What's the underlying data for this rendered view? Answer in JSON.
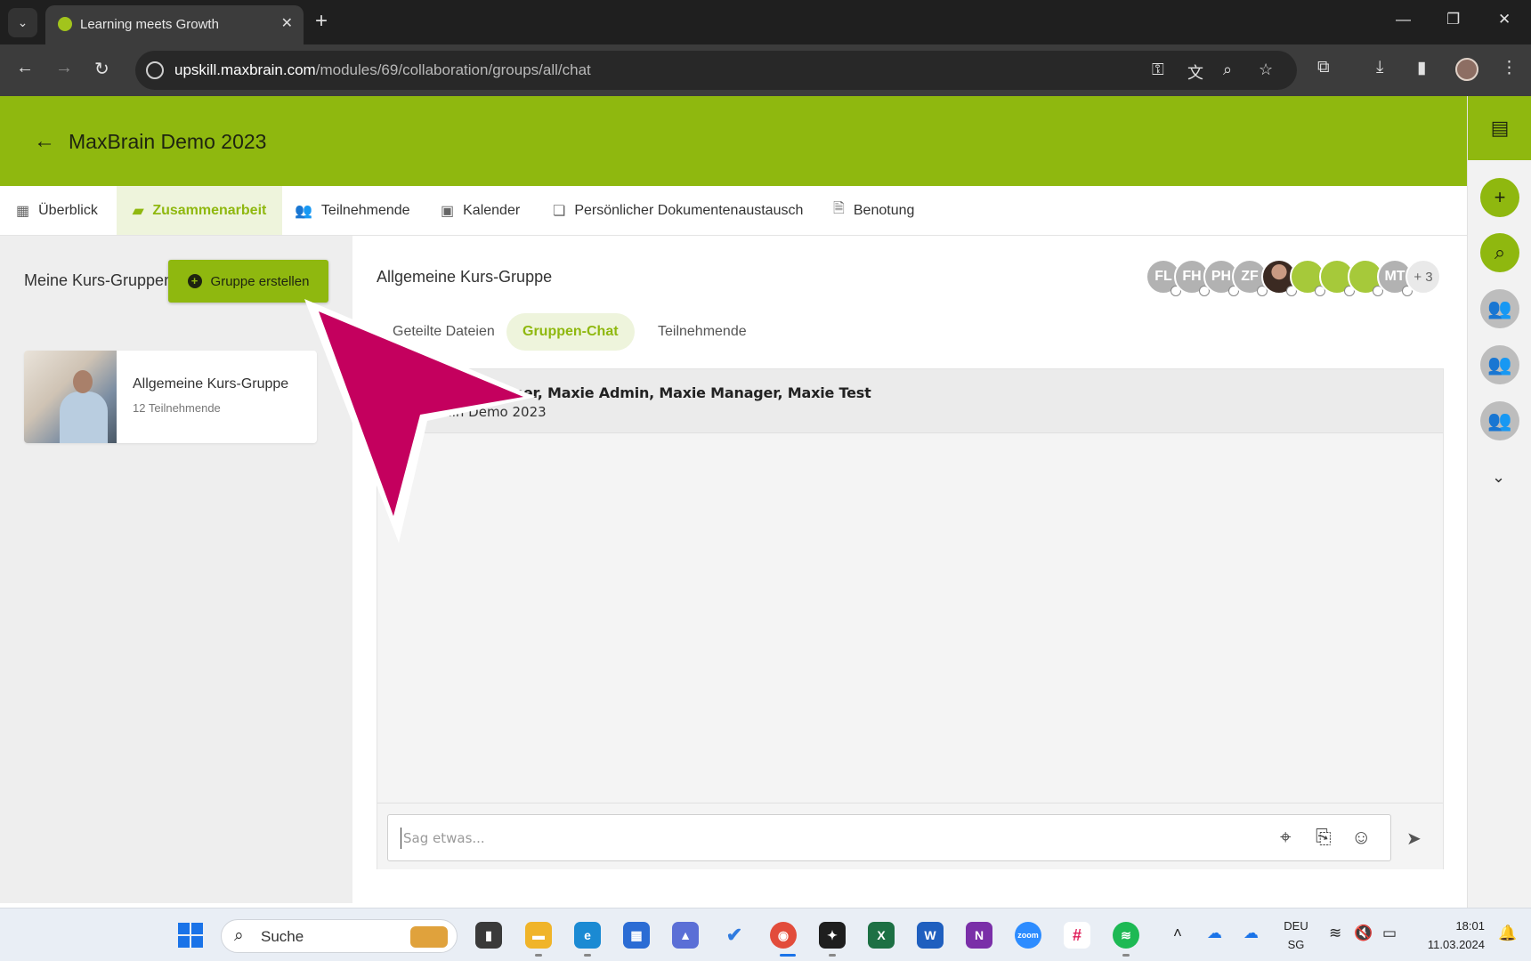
{
  "browser": {
    "tab_title": "Learning meets Growth",
    "url_domain": "upskill.maxbrain.com",
    "url_path": "/modules/69/collaboration/groups/all/chat"
  },
  "header": {
    "course_title": "MaxBrain Demo 2023"
  },
  "course_tabs": [
    {
      "label": "Überblick",
      "icon": "dashboard-icon"
    },
    {
      "label": "Zusammenarbeit",
      "icon": "folder-shared-icon",
      "active": true
    },
    {
      "label": "Teilnehmende",
      "icon": "people-icon"
    },
    {
      "label": "Kalender",
      "icon": "calendar-icon"
    },
    {
      "label": "Persönlicher Dokumentenaustausch",
      "icon": "documents-icon"
    },
    {
      "label": "Benotung",
      "icon": "grading-icon"
    }
  ],
  "left_panel": {
    "title": "Meine Kurs-Gruppen",
    "create_button": "Gruppe erstellen",
    "groups": [
      {
        "name": "Allgemeine Kurs-Gruppe",
        "count": "12 Teilnehmende"
      }
    ]
  },
  "chat": {
    "group_title": "Allgemeine Kurs-Gruppe",
    "avatars": [
      "FL",
      "FH",
      "PH",
      "ZF",
      "",
      "",
      "",
      "",
      "MT"
    ],
    "more_count": "+ 3",
    "sub_tabs": [
      {
        "label": "Geteilte Dateien"
      },
      {
        "label": "Gruppen-Chat",
        "active": true
      },
      {
        "label": "Teilnehmende"
      }
    ],
    "header_members": "ber, Frank Lyner, Maxie Admin, Maxie Manager, Maxie Test",
    "header_course": "axBrain Demo 2023",
    "composer_placeholder": "Sag etwas..."
  },
  "taskbar": {
    "search_label": "Suche",
    "lang_1": "DEU",
    "lang_2": "SG",
    "time": "18:01",
    "date": "11.03.2024"
  },
  "colors": {
    "brand_green": "#8fb80f",
    "pointer_magenta": "#c4005e"
  }
}
